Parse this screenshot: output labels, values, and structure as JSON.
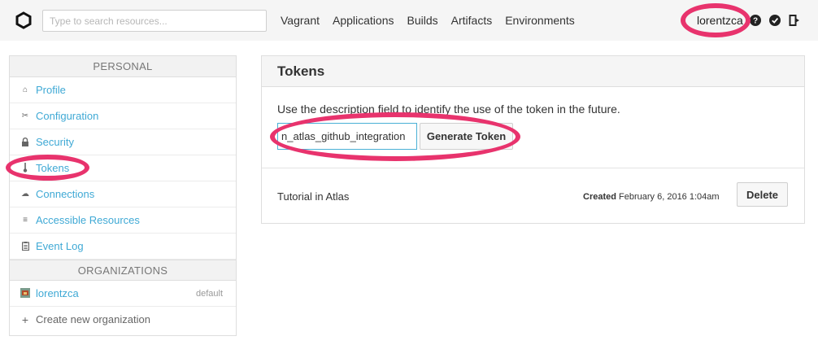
{
  "search": {
    "placeholder": "Type to search resources..."
  },
  "nav": [
    "Vagrant",
    "Applications",
    "Builds",
    "Artifacts",
    "Environments"
  ],
  "user": {
    "name": "lorentzca"
  },
  "sidebar": {
    "personal_heading": "PERSONAL",
    "items": [
      {
        "label": "Profile",
        "icon": "home-icon"
      },
      {
        "label": "Configuration",
        "icon": "tools-icon"
      },
      {
        "label": "Security",
        "icon": "lock-icon"
      },
      {
        "label": "Tokens",
        "icon": "thermometer-icon"
      },
      {
        "label": "Connections",
        "icon": "cloud-icon"
      },
      {
        "label": "Accessible Resources",
        "icon": "list-icon"
      },
      {
        "label": "Event Log",
        "icon": "clipboard-icon"
      }
    ],
    "orgs_heading": "ORGANIZATIONS",
    "orgs": [
      {
        "label": "lorentzca",
        "tag": "default"
      }
    ],
    "create_org": "Create new organization"
  },
  "tokens": {
    "title": "Tokens",
    "description": "Use the description field to identify the use of the token in the future.",
    "input_value": "n_atlas_github_integration",
    "generate_label": "Generate Token",
    "list": [
      {
        "name": "Tutorial in Atlas",
        "created_label": "Created",
        "created_value": "February 6, 2016 1:04am",
        "delete_label": "Delete"
      }
    ]
  },
  "colors": {
    "accent": "#3fa9d5",
    "annotation": "#e8336d"
  }
}
